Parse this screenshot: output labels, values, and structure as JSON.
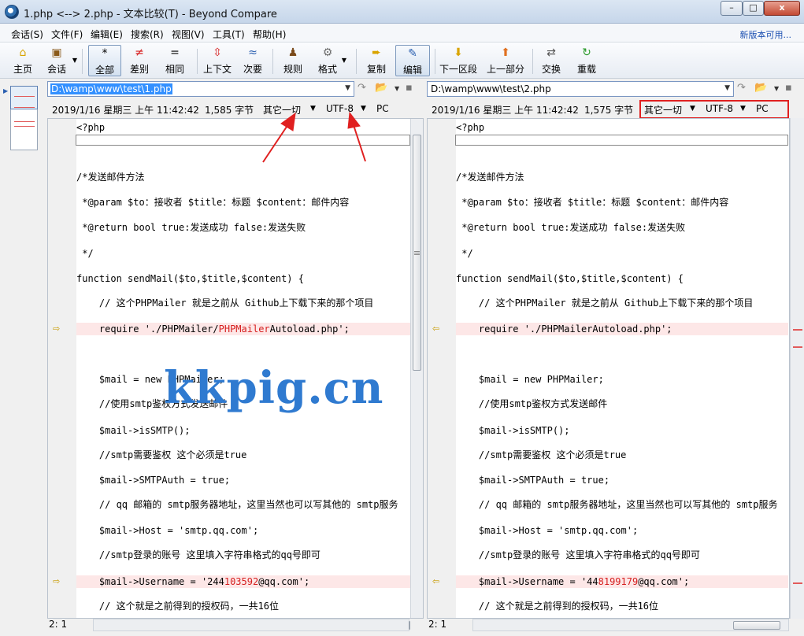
{
  "window": {
    "title": "1.php <--> 2.php - 文本比较(T) - Beyond Compare",
    "min_label": "–",
    "max_label": "□",
    "close_label": "x"
  },
  "menu": {
    "items": [
      "会话(S)",
      "文件(F)",
      "编辑(E)",
      "搜索(R)",
      "视图(V)",
      "工具(T)",
      "帮助(H)"
    ],
    "new_version": "新版本可用..."
  },
  "toolbar": {
    "home": "主页",
    "session": "会话",
    "all": "全部",
    "diffs": "差别",
    "same": "相同",
    "context": "上下文",
    "minor": "次要",
    "rules": "规则",
    "format": "格式",
    "copy": "复制",
    "edit": "编辑",
    "next_section": "下一区段",
    "prev_part": "上一部分",
    "swap": "交换",
    "reload": "重载"
  },
  "left": {
    "path": "D:\\wamp\\www\\test\\1.php",
    "date": "2019/1/16 星期三 上午 11:42:42",
    "size": "1,585 字节",
    "filter": "其它一切",
    "encoding": "UTF-8",
    "lineend": "PC",
    "status": "2: 1",
    "lines": [
      {
        "pre": "<?php"
      },
      {
        "pre": ""
      },
      {
        "pre": ""
      },
      {
        "pre": "/*发送邮件方法"
      },
      {
        "pre": " *@param $to：接收者 $title：标题 $content：邮件内容"
      },
      {
        "pre": " *@return bool true:发送成功 false:发送失败"
      },
      {
        "pre": " */"
      },
      {
        "pre": "function sendMail($to,$title,$content) {"
      },
      {
        "pre": "    // 这个PHPMailer 就是之前从 Github上下载下来的那个项目"
      },
      {
        "pre": "    require './PHPMailer/",
        "hl": "PHPMailer",
        "post": "Autoload.php';"
      },
      {
        "pre": ""
      },
      {
        "pre": "    $mail = new PHPMailer;"
      },
      {
        "pre": "    //使用smtp鉴权方式发送邮件"
      },
      {
        "pre": "    $mail->isSMTP();"
      },
      {
        "pre": "    //smtp需要鉴权 这个必须是true"
      },
      {
        "pre": "    $mail->SMTPAuth = true;"
      },
      {
        "pre": "    // qq 邮箱的 smtp服务器地址，这里当然也可以写其他的 smtp服务"
      },
      {
        "pre": "    $mail->Host = 'smtp.qq.com';"
      },
      {
        "pre": "    //smtp登录的账号 这里填入字符串格式的qq号即可"
      },
      {
        "pre": "    $mail->Username = '244",
        "hl": "103592",
        "post": "@qq.com';"
      },
      {
        "pre": "    // 这个就是之前得到的授权码，一共16位"
      }
    ]
  },
  "right": {
    "path": "D:\\wamp\\www\\test\\2.php",
    "date": "2019/1/16 星期三 上午 11:42:42",
    "size": "1,575 字节",
    "filter": "其它一切",
    "encoding": "UTF-8",
    "lineend": "PC",
    "status": "2: 1",
    "lines": [
      {
        "pre": "<?php"
      },
      {
        "pre": ""
      },
      {
        "pre": ""
      },
      {
        "pre": "/*发送邮件方法"
      },
      {
        "pre": " *@param $to：接收者 $title：标题 $content：邮件内容"
      },
      {
        "pre": " *@return bool true:发送成功 false:发送失败"
      },
      {
        "pre": " */"
      },
      {
        "pre": "function sendMail($to,$title,$content) {"
      },
      {
        "pre": "    // 这个PHPMailer 就是之前从 Github上下载下来的那个项目"
      },
      {
        "pre": "    require './PHPMailerAutoload.php';"
      },
      {
        "pre": ""
      },
      {
        "pre": "    $mail = new PHPMailer;"
      },
      {
        "pre": "    //使用smtp鉴权方式发送邮件"
      },
      {
        "pre": "    $mail->isSMTP();"
      },
      {
        "pre": "    //smtp需要鉴权 这个必须是true"
      },
      {
        "pre": "    $mail->SMTPAuth = true;"
      },
      {
        "pre": "    // qq 邮箱的 smtp服务器地址，这里当然也可以写其他的 smtp服务"
      },
      {
        "pre": "    $mail->Host = 'smtp.qq.com';"
      },
      {
        "pre": "    //smtp登录的账号 这里填入字符串格式的qq号即可"
      },
      {
        "pre": "    $mail->Username = '44",
        "hl": "8199179",
        "post": "@qq.com';"
      },
      {
        "pre": "    // 这个就是之前得到的授权码，一共16位"
      }
    ]
  },
  "diff_line_indices": [
    9,
    19
  ],
  "watermark": "kkpig.cn",
  "colors": {
    "diff_bg": "#fde7e7",
    "diff_text": "#d61f1f",
    "annotation": "#e02020",
    "watermark": "#2f7ad0"
  }
}
